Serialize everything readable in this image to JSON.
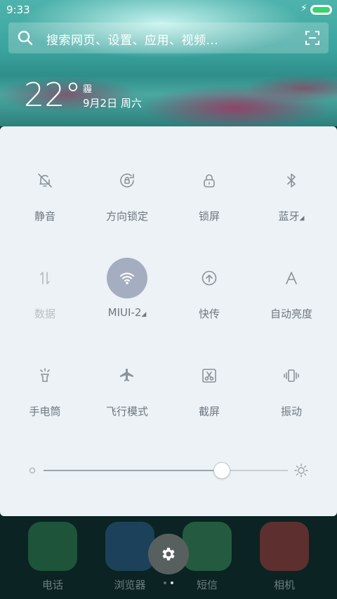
{
  "status": {
    "time": "9:33",
    "charging_symbol": "⚡"
  },
  "search": {
    "placeholder": "搜索网页、设置、应用、视频..."
  },
  "weather": {
    "temperature": "22°",
    "condition": "霾",
    "date": "9月2日 周六"
  },
  "toggles": [
    {
      "label": "静音",
      "icon": "bell-off-icon",
      "active": false,
      "disabled": false
    },
    {
      "label": "方向锁定",
      "icon": "rotation-lock-icon",
      "active": false,
      "disabled": false
    },
    {
      "label": "锁屏",
      "icon": "lock-icon",
      "active": false,
      "disabled": false
    },
    {
      "label": "蓝牙",
      "icon": "bluetooth-icon",
      "active": false,
      "disabled": false,
      "has_more": true
    },
    {
      "label": "数据",
      "icon": "data-transfer-icon",
      "active": false,
      "disabled": true
    },
    {
      "label": "MIUI-2",
      "icon": "wifi-icon",
      "active": true,
      "disabled": false,
      "has_more": true
    },
    {
      "label": "快传",
      "icon": "upload-icon",
      "active": false,
      "disabled": false
    },
    {
      "label": "自动亮度",
      "icon": "auto-brightness-icon",
      "active": false,
      "disabled": false
    },
    {
      "label": "手电筒",
      "icon": "flashlight-icon",
      "active": false,
      "disabled": false
    },
    {
      "label": "飞行模式",
      "icon": "airplane-icon",
      "active": false,
      "disabled": false
    },
    {
      "label": "截屏",
      "icon": "screenshot-icon",
      "active": false,
      "disabled": false
    },
    {
      "label": "振动",
      "icon": "vibrate-icon",
      "active": false,
      "disabled": false
    }
  ],
  "brightness": {
    "level_percent": 73
  },
  "dock": [
    {
      "label": "电话",
      "icon": "phone-icon",
      "color": "#2e7d4f"
    },
    {
      "label": "浏览器",
      "icon": "browser-icon",
      "color": "#2b5d8a"
    },
    {
      "label": "短信",
      "icon": "message-icon",
      "color": "#3b8a5a"
    },
    {
      "label": "相机",
      "icon": "camera-icon",
      "color": "#a23a3a"
    }
  ],
  "colors": {
    "panel": "#ecf2f5",
    "active_toggle": "#a4aec0",
    "label": "#6e7680"
  }
}
